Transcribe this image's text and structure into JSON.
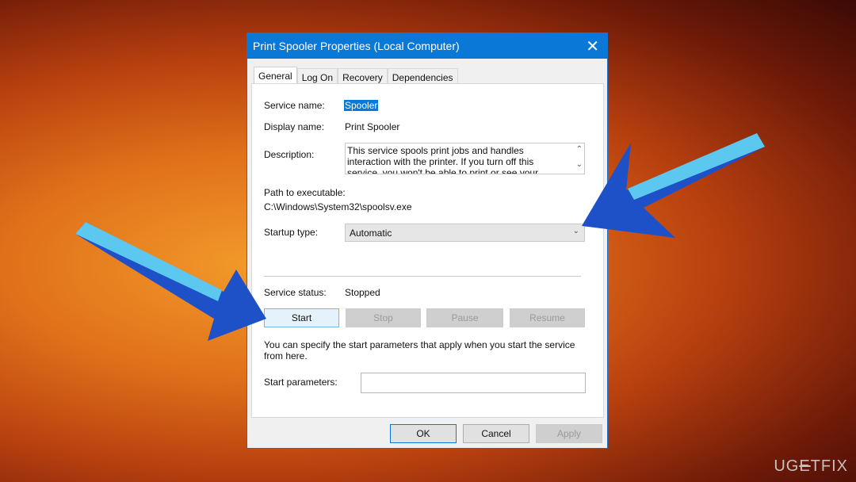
{
  "window": {
    "title": "Print Spooler Properties (Local Computer)",
    "close_icon": "close-icon"
  },
  "tabs": [
    {
      "label": "General",
      "active": true
    },
    {
      "label": "Log On"
    },
    {
      "label": "Recovery"
    },
    {
      "label": "Dependencies"
    }
  ],
  "general": {
    "service_name_label": "Service name:",
    "service_name": "Spooler",
    "display_name_label": "Display name:",
    "display_name": "Print Spooler",
    "description_label": "Description:",
    "description": "This service spools print jobs and handles interaction with the printer.  If you turn off this service, you won't be able to print or see your printers.",
    "path_label": "Path to executable:",
    "path": "C:\\Windows\\System32\\spoolsv.exe",
    "startup_label": "Startup type:",
    "startup_value": "Automatic",
    "status_label": "Service status:",
    "status": "Stopped",
    "buttons": {
      "start": "Start",
      "stop": "Stop",
      "pause": "Pause",
      "resume": "Resume"
    },
    "hint": "You can specify the start parameters that apply when you start the service from here.",
    "params_label": "Start parameters:",
    "params_value": ""
  },
  "footer": {
    "ok": "OK",
    "cancel": "Cancel",
    "apply": "Apply"
  },
  "watermark": "UGETFIX",
  "colors": {
    "accent": "#0a78d7",
    "arrow": "#1e50c8",
    "arrow_highlight": "#5cc8f0"
  }
}
